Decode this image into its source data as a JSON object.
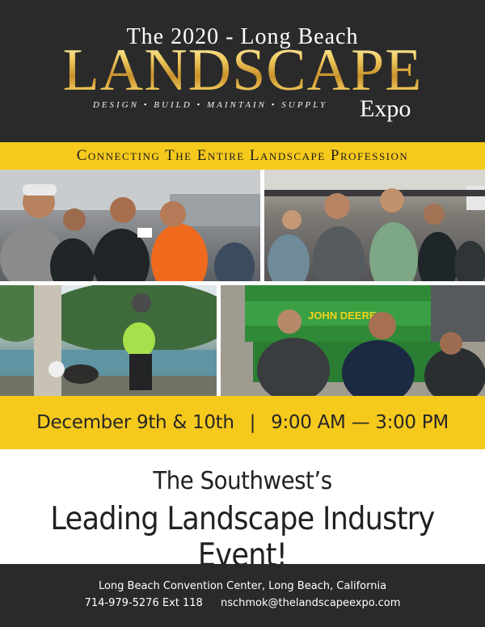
{
  "header": {
    "title_top": "The 2020 - Long Beach",
    "title_main": "LANDSCAPE",
    "tagline": "DESIGN • BUILD • MAINTAIN • SUPPLY",
    "title_suffix": "Expo"
  },
  "banner": {
    "text": "Connecting The Entire Landscape Profession"
  },
  "photos": {
    "tractor_brand": "JOHN DEERE"
  },
  "event": {
    "dates": "December 9th & 10th",
    "separator": "|",
    "hours": "9:00 AM — 3:00 PM"
  },
  "headline": {
    "line1": "The Southwest’s",
    "line2": "Leading Landscape Industry Event!"
  },
  "footer": {
    "venue": "Long Beach Convention Center, Long Beach, California",
    "phone": "714-979-5276 Ext 118",
    "email": "nschmok@thelandscapeexpo.com"
  },
  "colors": {
    "header_bg": "#2b2a2b",
    "accent_yellow": "#f6c91d",
    "title_gold": "#e5b74a",
    "text_dark": "#231f20"
  }
}
